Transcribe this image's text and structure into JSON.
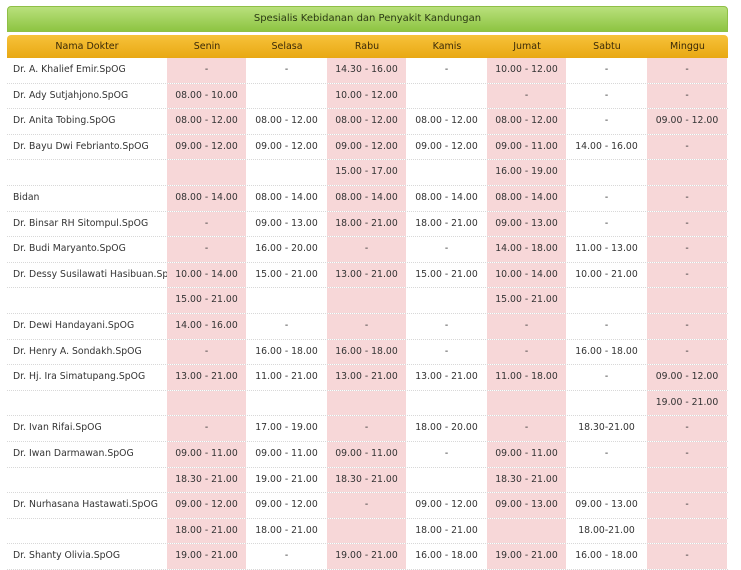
{
  "table": {
    "title": "Spesialis Kebidanan dan Penyakit Kandungan",
    "headers": [
      "Nama Dokter",
      "Senin",
      "Selasa",
      "Rabu",
      "Kamis",
      "Jumat",
      "Sabtu",
      "Minggu"
    ],
    "rows": [
      [
        "Dr. A. Khalief Emir.SpOG",
        "-",
        "-",
        "14.30 - 16.00",
        "-",
        "10.00 - 12.00",
        "-",
        "-"
      ],
      [
        "Dr. Ady Sutjahjono.SpOG",
        "08.00 - 10.00",
        "",
        "10.00 - 12.00",
        "",
        "-",
        "-",
        "-"
      ],
      [
        "Dr. Anita Tobing.SpOG",
        "08.00 - 12.00",
        "08.00 - 12.00",
        "08.00 - 12.00",
        "08.00 - 12.00",
        "08.00 - 12.00",
        "-",
        "09.00 - 12.00"
      ],
      [
        "Dr. Bayu Dwi Febrianto.SpOG",
        "09.00 - 12.00",
        "09.00 - 12.00",
        "09.00 - 12.00",
        "09.00 - 12.00",
        "09.00 - 11.00",
        "14.00 - 16.00",
        "-"
      ],
      [
        "",
        "",
        "",
        "15.00 - 17.00",
        "",
        "16.00 - 19.00",
        "",
        ""
      ],
      [
        "Bidan",
        "08.00 - 14.00",
        "08.00 - 14.00",
        "08.00 - 14.00",
        "08.00 - 14.00",
        "08.00 - 14.00",
        "-",
        "-"
      ],
      [
        "Dr. Binsar RH Sitompul.SpOG",
        "-",
        "09.00 - 13.00",
        "18.00 - 21.00",
        "18.00 - 21.00",
        "09.00 - 13.00",
        "-",
        "-"
      ],
      [
        "Dr. Budi Maryanto.SpOG",
        "-",
        "16.00 - 20.00",
        "-",
        "-",
        "14.00 - 18.00",
        "11.00 - 13.00",
        "-"
      ],
      [
        "Dr. Dessy Susilawati Hasibuan.SpOG",
        "10.00 - 14.00",
        "15.00 - 21.00",
        "13.00 - 21.00",
        "15.00 - 21.00",
        "10.00 - 14.00",
        "10.00 - 21.00",
        "-"
      ],
      [
        "",
        "15.00 - 21.00",
        "",
        "",
        "",
        "15.00 - 21.00",
        "",
        ""
      ],
      [
        "Dr. Dewi Handayani.SpOG",
        "14.00 - 16.00",
        "-",
        "-",
        "-",
        "-",
        "-",
        "-"
      ],
      [
        "Dr. Henry A. Sondakh.SpOG",
        "-",
        "16.00 - 18.00",
        "16.00 - 18.00",
        "-",
        "-",
        "16.00 - 18.00",
        "-"
      ],
      [
        "Dr. Hj. Ira Simatupang.SpOG",
        "13.00 - 21.00",
        "11.00 - 21.00",
        "13.00 - 21.00",
        "13.00 - 21.00",
        "11.00 - 18.00",
        "-",
        "09.00 - 12.00"
      ],
      [
        "",
        "",
        "",
        "",
        "",
        "",
        "",
        "19.00 - 21.00"
      ],
      [
        "Dr. Ivan Rifai.SpOG",
        "-",
        "17.00 - 19.00",
        "-",
        "18.00 - 20.00",
        "-",
        "18.30-21.00",
        "-"
      ],
      [
        "Dr. Iwan Darmawan.SpOG",
        "09.00 - 11.00",
        "09.00 - 11.00",
        "09.00 - 11.00",
        "-",
        "09.00 - 11.00",
        "-",
        "-"
      ],
      [
        "",
        "18.30 - 21.00",
        "19.00 - 21.00",
        "18.30 - 21.00",
        "",
        "18.30 - 21.00",
        "",
        ""
      ],
      [
        "Dr. Nurhasana Hastawati.SpOG",
        "09.00 - 12.00",
        "09.00 - 12.00",
        "-",
        "09.00 - 12.00",
        "09.00 - 13.00",
        "09.00 - 13.00",
        "-"
      ],
      [
        "",
        "18.00 - 21.00",
        "18.00 - 21.00",
        "",
        "18.00 - 21.00",
        "",
        "18.00-21.00",
        ""
      ],
      [
        "Dr. Shanty Olivia.SpOG",
        "19.00 - 21.00",
        "-",
        "19.00 - 21.00",
        "16.00 - 18.00",
        "19.00 - 21.00",
        "16.00 - 18.00",
        "-"
      ]
    ]
  },
  "colors": {
    "title_bar": "#9fd058",
    "header_row": "#efb42a",
    "shaded_day": "#f7d7d8"
  }
}
